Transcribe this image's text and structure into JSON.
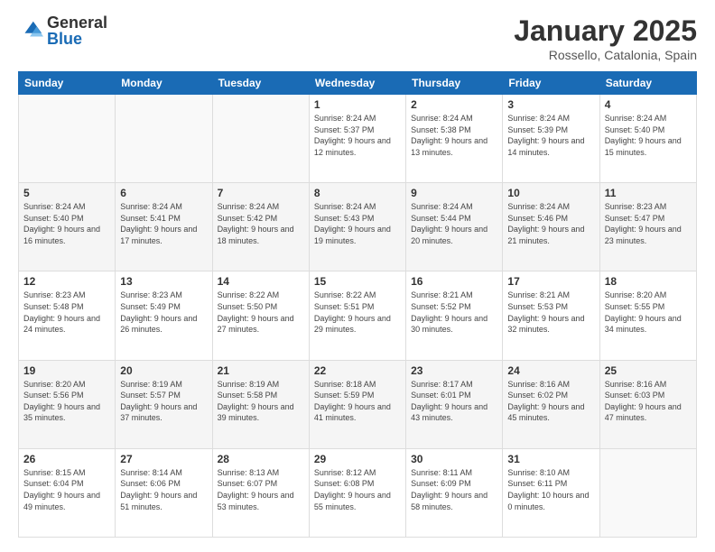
{
  "header": {
    "logo_general": "General",
    "logo_blue": "Blue",
    "month_title": "January 2025",
    "location": "Rossello, Catalonia, Spain"
  },
  "days_of_week": [
    "Sunday",
    "Monday",
    "Tuesday",
    "Wednesday",
    "Thursday",
    "Friday",
    "Saturday"
  ],
  "weeks": [
    [
      {
        "day": "",
        "info": ""
      },
      {
        "day": "",
        "info": ""
      },
      {
        "day": "",
        "info": ""
      },
      {
        "day": "1",
        "info": "Sunrise: 8:24 AM\nSunset: 5:37 PM\nDaylight: 9 hours\nand 12 minutes."
      },
      {
        "day": "2",
        "info": "Sunrise: 8:24 AM\nSunset: 5:38 PM\nDaylight: 9 hours\nand 13 minutes."
      },
      {
        "day": "3",
        "info": "Sunrise: 8:24 AM\nSunset: 5:39 PM\nDaylight: 9 hours\nand 14 minutes."
      },
      {
        "day": "4",
        "info": "Sunrise: 8:24 AM\nSunset: 5:40 PM\nDaylight: 9 hours\nand 15 minutes."
      }
    ],
    [
      {
        "day": "5",
        "info": "Sunrise: 8:24 AM\nSunset: 5:40 PM\nDaylight: 9 hours\nand 16 minutes."
      },
      {
        "day": "6",
        "info": "Sunrise: 8:24 AM\nSunset: 5:41 PM\nDaylight: 9 hours\nand 17 minutes."
      },
      {
        "day": "7",
        "info": "Sunrise: 8:24 AM\nSunset: 5:42 PM\nDaylight: 9 hours\nand 18 minutes."
      },
      {
        "day": "8",
        "info": "Sunrise: 8:24 AM\nSunset: 5:43 PM\nDaylight: 9 hours\nand 19 minutes."
      },
      {
        "day": "9",
        "info": "Sunrise: 8:24 AM\nSunset: 5:44 PM\nDaylight: 9 hours\nand 20 minutes."
      },
      {
        "day": "10",
        "info": "Sunrise: 8:24 AM\nSunset: 5:46 PM\nDaylight: 9 hours\nand 21 minutes."
      },
      {
        "day": "11",
        "info": "Sunrise: 8:23 AM\nSunset: 5:47 PM\nDaylight: 9 hours\nand 23 minutes."
      }
    ],
    [
      {
        "day": "12",
        "info": "Sunrise: 8:23 AM\nSunset: 5:48 PM\nDaylight: 9 hours\nand 24 minutes."
      },
      {
        "day": "13",
        "info": "Sunrise: 8:23 AM\nSunset: 5:49 PM\nDaylight: 9 hours\nand 26 minutes."
      },
      {
        "day": "14",
        "info": "Sunrise: 8:22 AM\nSunset: 5:50 PM\nDaylight: 9 hours\nand 27 minutes."
      },
      {
        "day": "15",
        "info": "Sunrise: 8:22 AM\nSunset: 5:51 PM\nDaylight: 9 hours\nand 29 minutes."
      },
      {
        "day": "16",
        "info": "Sunrise: 8:21 AM\nSunset: 5:52 PM\nDaylight: 9 hours\nand 30 minutes."
      },
      {
        "day": "17",
        "info": "Sunrise: 8:21 AM\nSunset: 5:53 PM\nDaylight: 9 hours\nand 32 minutes."
      },
      {
        "day": "18",
        "info": "Sunrise: 8:20 AM\nSunset: 5:55 PM\nDaylight: 9 hours\nand 34 minutes."
      }
    ],
    [
      {
        "day": "19",
        "info": "Sunrise: 8:20 AM\nSunset: 5:56 PM\nDaylight: 9 hours\nand 35 minutes."
      },
      {
        "day": "20",
        "info": "Sunrise: 8:19 AM\nSunset: 5:57 PM\nDaylight: 9 hours\nand 37 minutes."
      },
      {
        "day": "21",
        "info": "Sunrise: 8:19 AM\nSunset: 5:58 PM\nDaylight: 9 hours\nand 39 minutes."
      },
      {
        "day": "22",
        "info": "Sunrise: 8:18 AM\nSunset: 5:59 PM\nDaylight: 9 hours\nand 41 minutes."
      },
      {
        "day": "23",
        "info": "Sunrise: 8:17 AM\nSunset: 6:01 PM\nDaylight: 9 hours\nand 43 minutes."
      },
      {
        "day": "24",
        "info": "Sunrise: 8:16 AM\nSunset: 6:02 PM\nDaylight: 9 hours\nand 45 minutes."
      },
      {
        "day": "25",
        "info": "Sunrise: 8:16 AM\nSunset: 6:03 PM\nDaylight: 9 hours\nand 47 minutes."
      }
    ],
    [
      {
        "day": "26",
        "info": "Sunrise: 8:15 AM\nSunset: 6:04 PM\nDaylight: 9 hours\nand 49 minutes."
      },
      {
        "day": "27",
        "info": "Sunrise: 8:14 AM\nSunset: 6:06 PM\nDaylight: 9 hours\nand 51 minutes."
      },
      {
        "day": "28",
        "info": "Sunrise: 8:13 AM\nSunset: 6:07 PM\nDaylight: 9 hours\nand 53 minutes."
      },
      {
        "day": "29",
        "info": "Sunrise: 8:12 AM\nSunset: 6:08 PM\nDaylight: 9 hours\nand 55 minutes."
      },
      {
        "day": "30",
        "info": "Sunrise: 8:11 AM\nSunset: 6:09 PM\nDaylight: 9 hours\nand 58 minutes."
      },
      {
        "day": "31",
        "info": "Sunrise: 8:10 AM\nSunset: 6:11 PM\nDaylight: 10 hours\nand 0 minutes."
      },
      {
        "day": "",
        "info": ""
      }
    ]
  ]
}
